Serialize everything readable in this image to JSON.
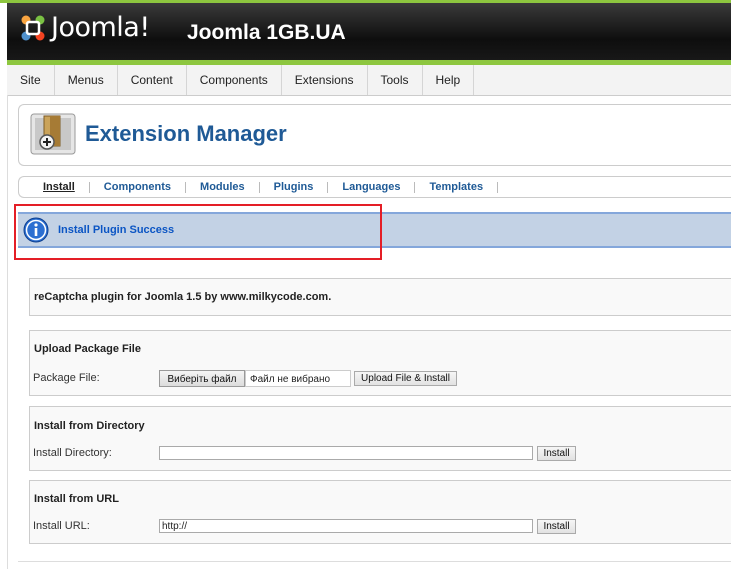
{
  "header": {
    "logo_text": "Joomla!",
    "site_title": "Joomla 1GB.UA"
  },
  "menu": {
    "items": [
      "Site",
      "Menus",
      "Content",
      "Components",
      "Extensions",
      "Tools",
      "Help"
    ]
  },
  "page": {
    "title": "Extension Manager"
  },
  "submenu": {
    "items": [
      "Install",
      "Components",
      "Modules",
      "Plugins",
      "Languages",
      "Templates"
    ]
  },
  "message": {
    "text": "Install Plugin Success"
  },
  "plugin": {
    "description": "reCaptcha plugin for Joomla 1.5 by www.milkycode.com."
  },
  "upload": {
    "title": "Upload Package File",
    "label": "Package File:",
    "browse_label": "Виберіть файл",
    "file_status": "Файл не вибрано",
    "button_label": "Upload File & Install"
  },
  "directory": {
    "title": "Install from Directory",
    "label": "Install Directory:",
    "value": "",
    "button_label": "Install"
  },
  "url": {
    "title": "Install from URL",
    "label": "Install URL:",
    "value": "http://",
    "button_label": "Install"
  },
  "colors": {
    "brand_green": "#8dc63f",
    "title_blue": "#1f5a96",
    "highlight_red": "#e41e26",
    "message_bg": "#c3d2e5"
  },
  "icons": {
    "logo": "joomla-logo",
    "extension": "extension-manager-icon",
    "info": "info-icon"
  }
}
